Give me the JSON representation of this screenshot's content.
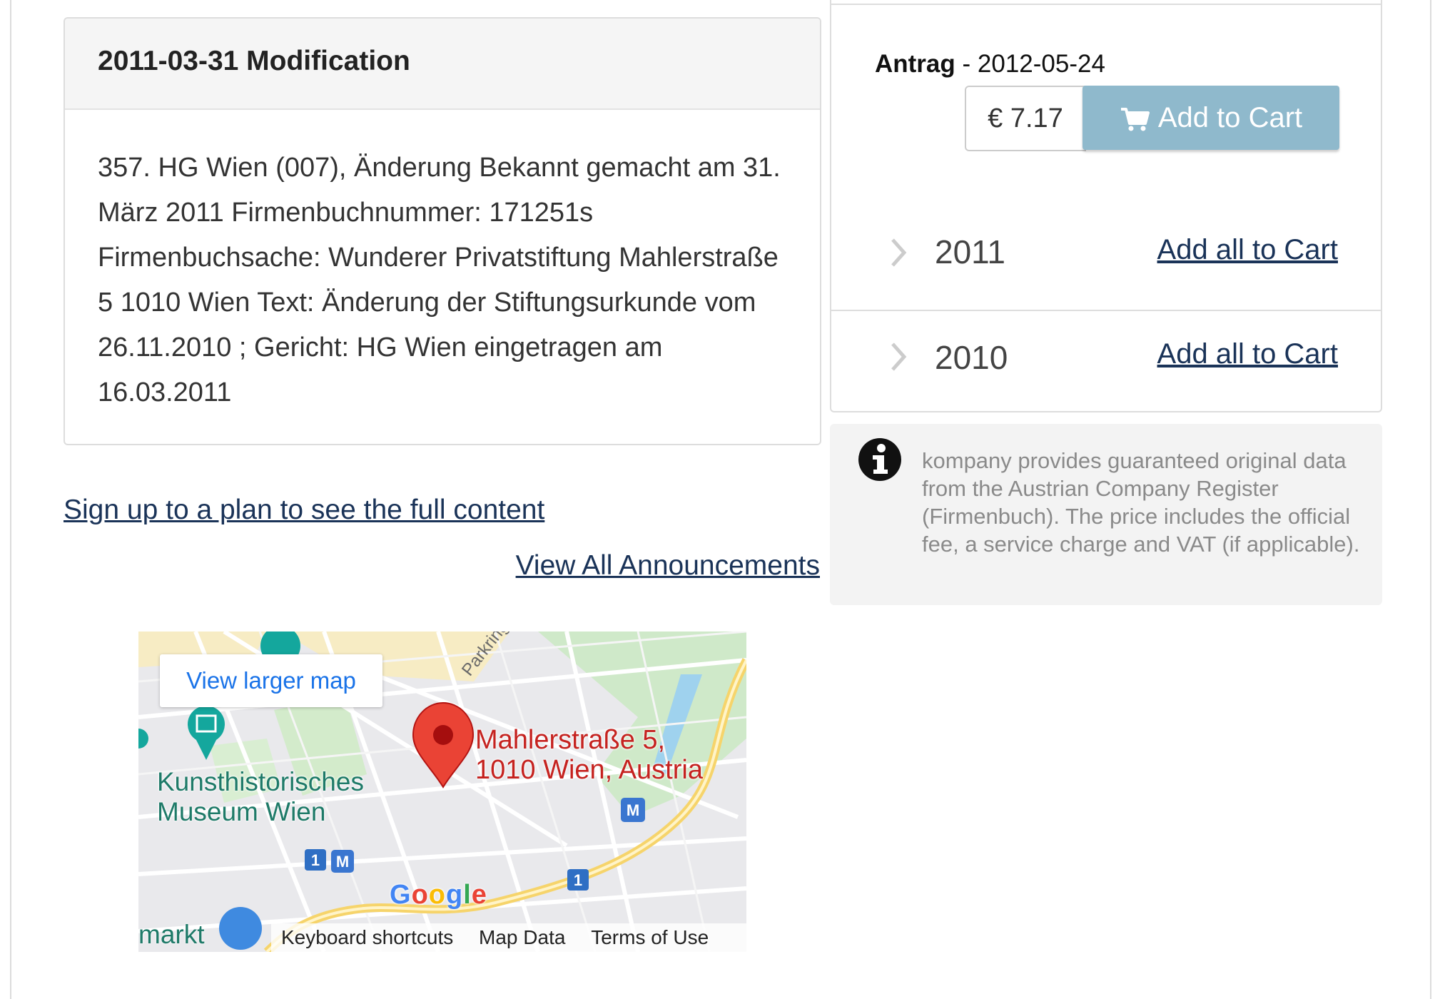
{
  "announcement": {
    "heading": "2011-03-31 Modification",
    "body": "357. HG Wien (007), Änderung Bekannt gemacht am 31. März 2011 Firmenbuchnummer: 171251s Firmenbuchsache: Wunderer Privatstiftung Mahlerstraße 5 1010 Wien Text: Änderung der Stiftungsurkunde vom 26.11.2010 ; Gericht: HG Wien eingetragen am 16.03.2011"
  },
  "links": {
    "signup": "Sign up to a plan to see the full content",
    "view_all": "View All Announcements"
  },
  "map": {
    "view_larger": "View larger map",
    "address_line1": "Mahlerstraße 5,",
    "address_line2": "1010 Wien, Austria",
    "poi_line1": "Kunsthistorisches",
    "poi_line2": "Museum Wien",
    "road_label": "Parkring",
    "partial_label": "markt",
    "footer": {
      "keyboard": "Keyboard shortcuts",
      "map_data": "Map Data",
      "terms": "Terms of Use"
    }
  },
  "cart": {
    "document_type": "Antrag",
    "separator": " - ",
    "document_date": "2012-05-24",
    "price": "€ 7.17",
    "add_button": "Add to Cart",
    "years": [
      {
        "year": "2011",
        "action": "Add all to Cart"
      },
      {
        "year": "2010",
        "action": "Add all to Cart"
      }
    ]
  },
  "info": {
    "text": "kompany provides guaranteed original data from the Austrian Company Register (Firmenbuch). The price includes the official fee, a service charge and VAT (if applicable)."
  },
  "colors": {
    "link": "#1a3358",
    "button": "#8fb9cc",
    "map_pin": "#ea4335",
    "info_text": "#8a8a8a"
  }
}
